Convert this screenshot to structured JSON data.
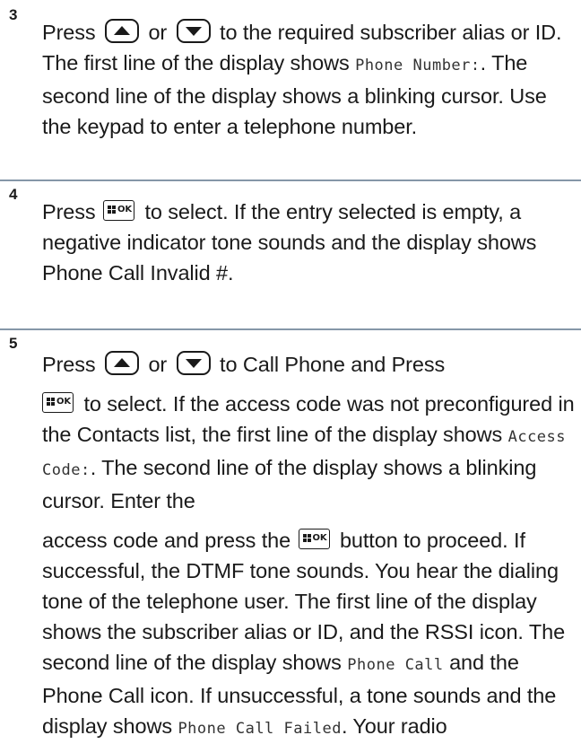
{
  "steps": [
    {
      "number": "3",
      "press": "Press",
      "or": "or",
      "after_keys": "to the required subscriber alias or ID. The first line of the display shows",
      "mono1": "Phone Number:",
      "after_mono1": ". The second line of the display shows a blinking cursor. Use the keypad to enter a telephone number."
    },
    {
      "number": "4",
      "press": "Press",
      "after_ok": "to select. If the entry selected is empty, a negative indicator tone sounds and the display shows Phone Call Invalid #."
    },
    {
      "number": "5",
      "press": "Press",
      "or": "or",
      "after_keys": "to Call Phone and Press",
      "after_ok1": "to select. If the access code was not preconfigured in the Contacts list, the first line of the display shows",
      "mono_access": "Access Code:",
      "after_access": ". The second line of the display shows a blinking cursor. Enter the",
      "access_code_press": "access code and press the",
      "after_ok2": "button to proceed. If successful, the DTMF tone sounds. You hear the dialing tone of the telephone user. The first line of the display shows the subscriber alias or ID, and the RSSI icon. The second line of the display shows",
      "mono_phone_call": "Phone Call",
      "after_phone_call": "and the Phone Call icon. If unsuccessful, a tone sounds and the display shows",
      "mono_failed": "Phone Call Failed",
      "after_failed": ". Your radio"
    }
  ],
  "keys": {
    "ok_label": "OK",
    "up_icon": "up-arrow-key-icon",
    "down_icon": "down-arrow-key-icon",
    "menu_icon": "menu-ok-key-icon"
  },
  "colors": {
    "divider": "#8597a8",
    "text": "#1a1a1a"
  }
}
